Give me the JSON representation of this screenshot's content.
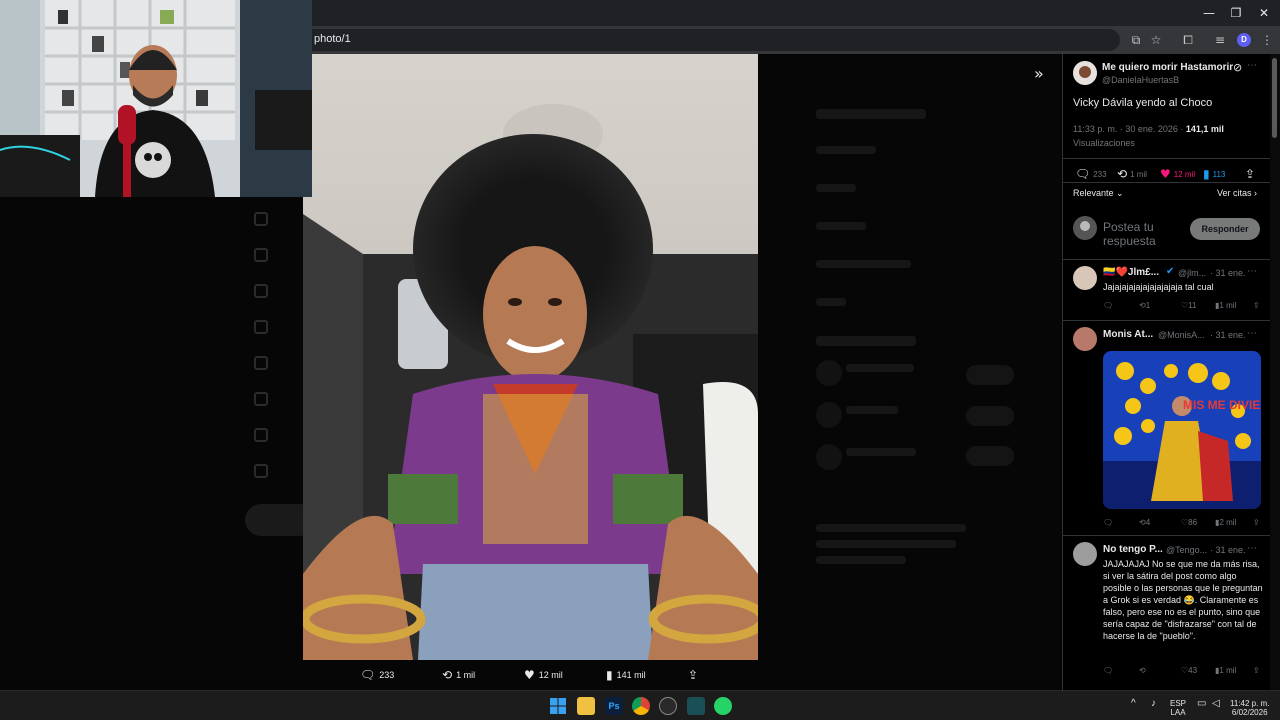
{
  "browser": {
    "url_fragment": "photo/1",
    "window_controls": {
      "minimize": "—",
      "maximize": "❐",
      "close": "✕"
    },
    "profile_initial": "D"
  },
  "media": {
    "stats": {
      "replies": "233",
      "reposts": "1 mil",
      "likes": "12 mil",
      "views": "141 mil"
    }
  },
  "tweet": {
    "display_name": "Me quiero morir Hastamorir",
    "handle": "@DanielaHuertasB",
    "text": "Vicky Dávila yendo al Choco",
    "time": "11:33 p. m. · 30 ene. 2026 · ",
    "views_count": "141,1 mil",
    "views_label": "Visualizaciones",
    "stats": {
      "replies": "233",
      "reposts": "1 mil",
      "likes": "12 mil",
      "bookmarks": "113"
    },
    "sort_label": "Relevante",
    "quotes_link": "Ver citas"
  },
  "composer": {
    "placeholder": "Postea tu respuesta",
    "button": "Responder"
  },
  "replies": [
    {
      "name": "🇨🇴❤️Jlm£...",
      "handle": "@jlm...",
      "date": "· 31 ene.",
      "text": "Jajajajajajajajajajaja tal cual",
      "reposts": "1",
      "likes": "11",
      "views": "1 mil"
    },
    {
      "name": "Monis At...",
      "handle": "@MonisA...",
      "date": "· 31 ene.",
      "image_text": "MIS ME DIVIERTE",
      "reposts": "4",
      "likes": "86",
      "views": "2 mil"
    },
    {
      "name": "No tengo P...",
      "handle": "@Tengo...",
      "date": "· 31 ene.",
      "text": "JAJAJAJAJ No se que me da más risa, si ver la sátira del post como algo posible o las personas que le preguntan a Grok si es verdad 😂. Claramente es falso, pero ese no es el punto, sino que sería capaz de \"disfrazarse\" con tal de hacerse la de \"pueblo\".",
      "likes": "43",
      "views": "1 mil"
    }
  ],
  "taskbar": {
    "lang": "ESP",
    "layout": "LAA",
    "time": "11:42 p. m.",
    "date": "6/02/2026"
  },
  "colors": {
    "like": "#f91880",
    "bookmark": "#1d9bf0",
    "verified": "#1d9bf0",
    "background": "#000000"
  }
}
